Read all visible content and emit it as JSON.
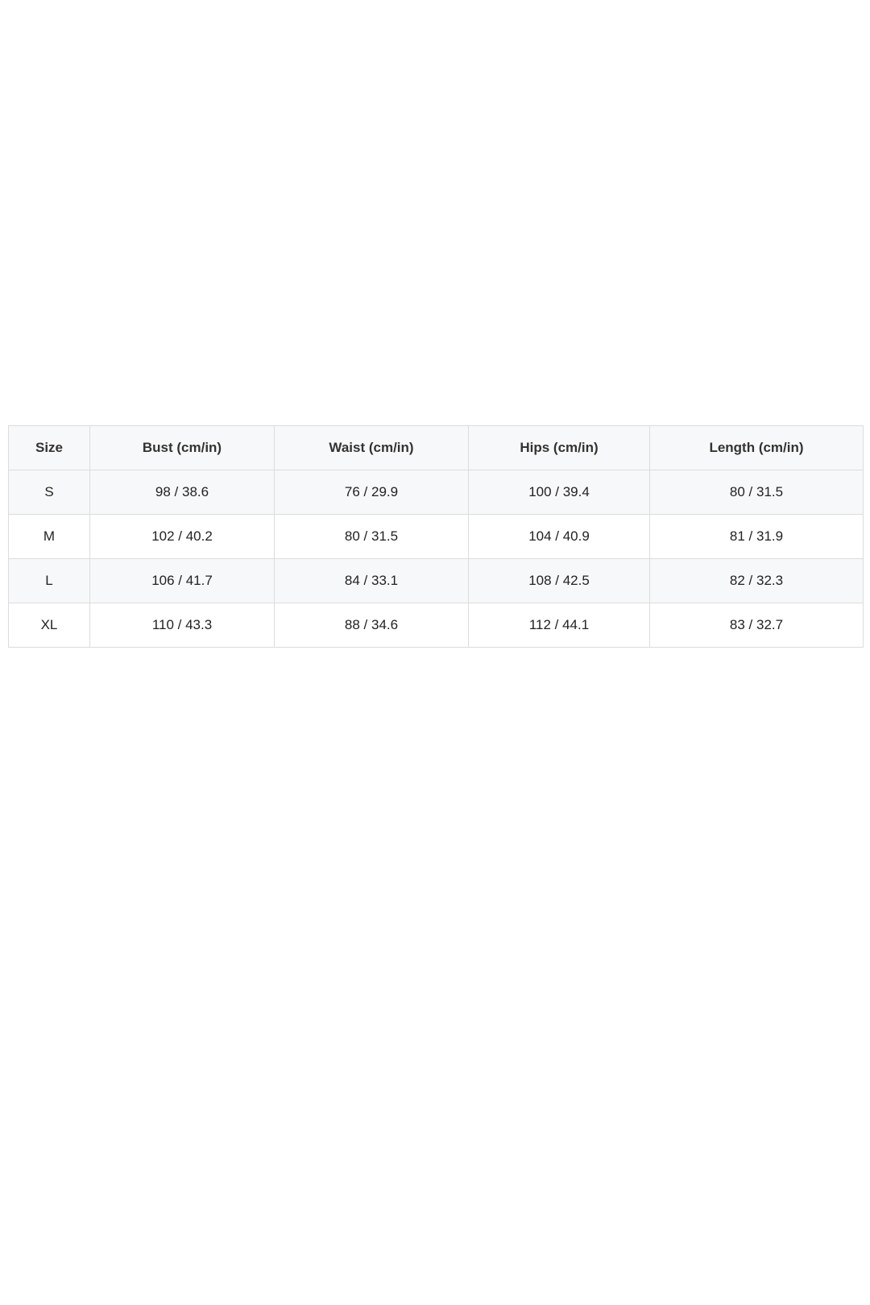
{
  "size_chart": {
    "headers": [
      "Size",
      "Bust (cm/in)",
      "Waist (cm/in)",
      "Hips (cm/in)",
      "Length (cm/in)"
    ],
    "rows": [
      [
        "S",
        "98 / 38.6",
        "76 / 29.9",
        "100 / 39.4",
        "80 / 31.5"
      ],
      [
        "M",
        "102 / 40.2",
        "80 / 31.5",
        "104 / 40.9",
        "81 / 31.9"
      ],
      [
        "L",
        "106 / 41.7",
        "84 / 33.1",
        "108 / 42.5",
        "82 / 32.3"
      ],
      [
        "XL",
        "110 / 43.3",
        "88 / 34.6",
        "112 / 44.1",
        "83 / 32.7"
      ]
    ]
  },
  "colors": {
    "header_background": "#f7f8f9",
    "border": "#dcdcdc",
    "text": "#222222"
  }
}
